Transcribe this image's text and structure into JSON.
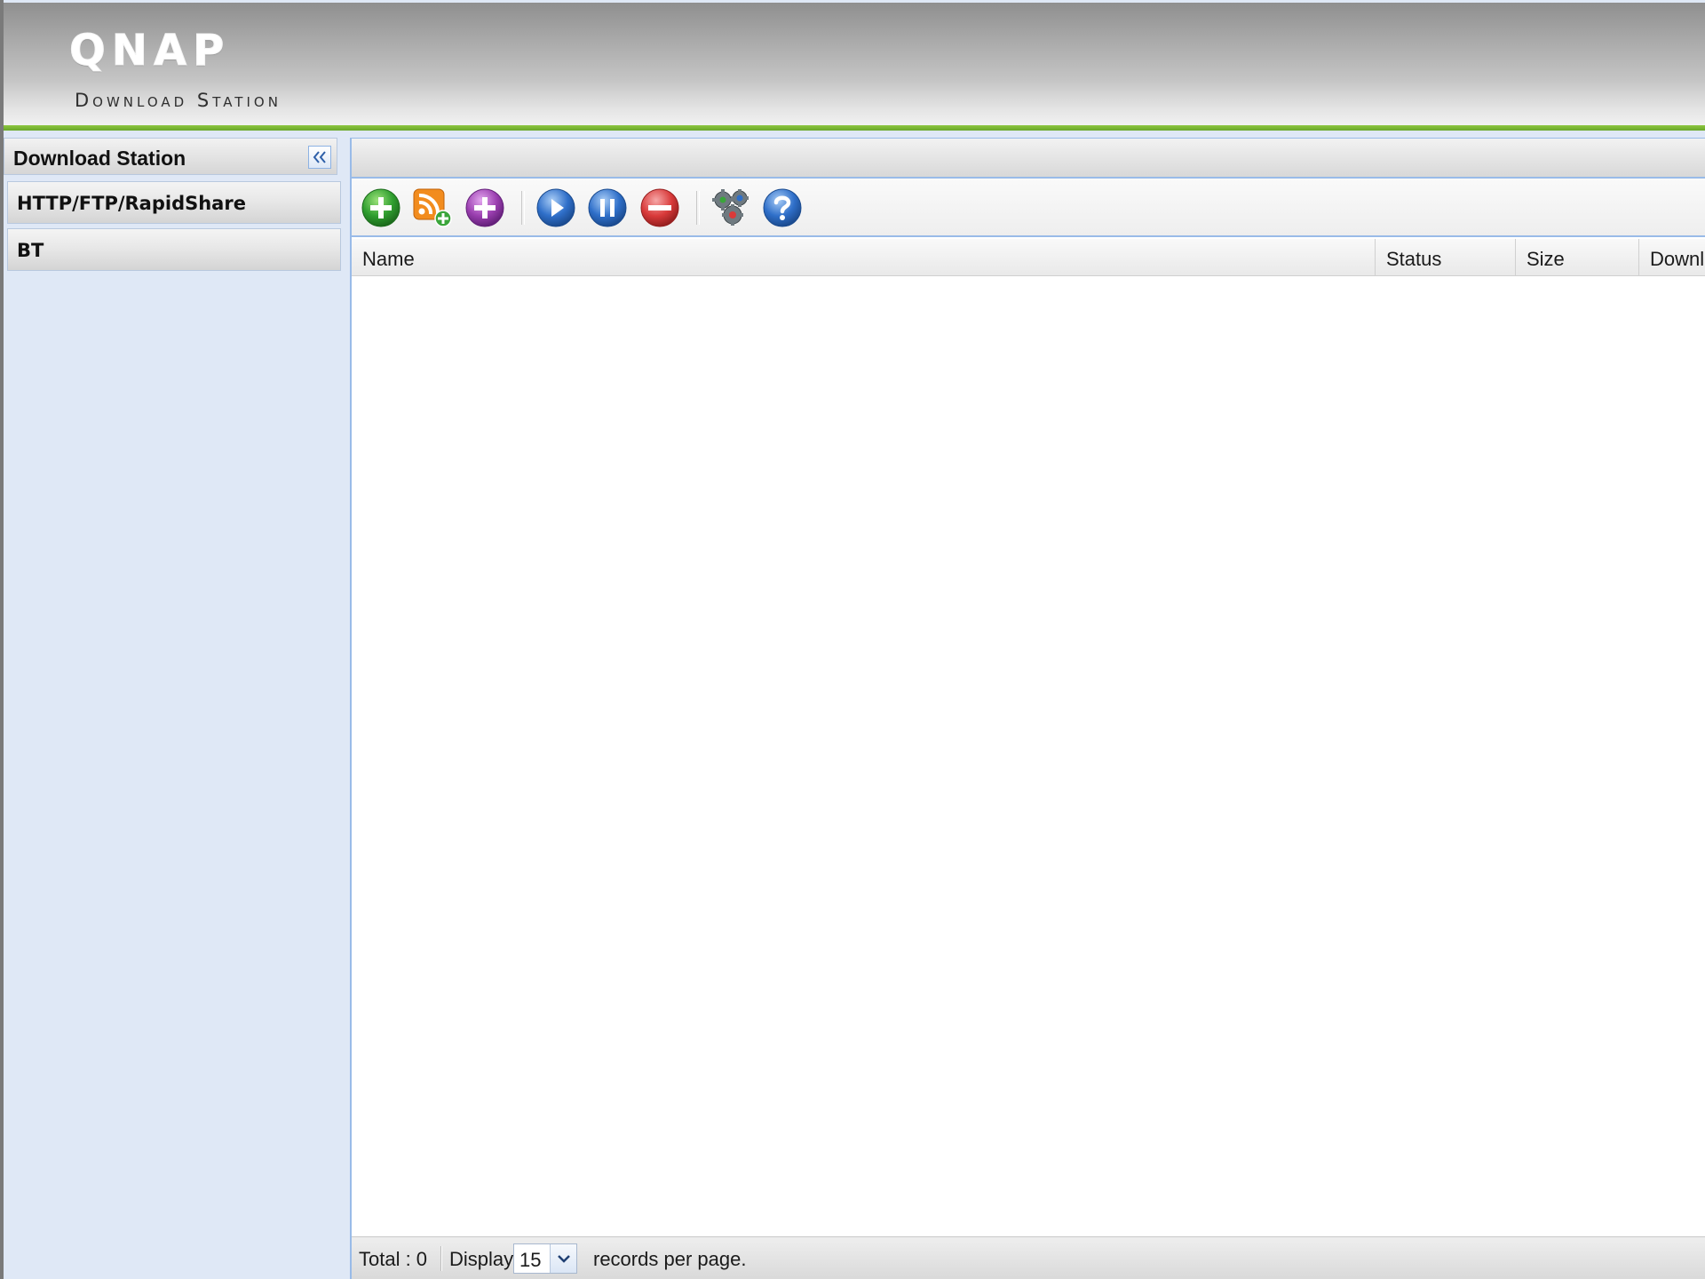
{
  "header": {
    "logo": "QNAP",
    "subtitle": "Download Station"
  },
  "sidebar": {
    "title": "Download Station",
    "collapse_icon": "double-chevron-left-icon",
    "items": [
      {
        "label": "HTTP/FTP/RapidShare"
      },
      {
        "label": "BT"
      }
    ]
  },
  "toolbar": {
    "buttons": [
      {
        "icon": "add-icon",
        "color": "#2f9e2f"
      },
      {
        "icon": "rss-add-icon",
        "color": "#f28c1e"
      },
      {
        "icon": "add-purple-icon",
        "color": "#9b3fb0"
      },
      {
        "icon": "play-icon",
        "color": "#2f6fc9"
      },
      {
        "icon": "pause-icon",
        "color": "#2f6fc9"
      },
      {
        "icon": "remove-icon",
        "color": "#d93a3a"
      },
      {
        "icon": "settings-gears-icon",
        "color": "#6f7a80"
      },
      {
        "icon": "help-icon",
        "color": "#2f6fc9"
      }
    ]
  },
  "grid": {
    "columns": [
      {
        "label": "Name"
      },
      {
        "label": "Status"
      },
      {
        "label": "Size"
      },
      {
        "label": "Downl"
      }
    ],
    "rows": []
  },
  "paging": {
    "total_label": "Total : 0",
    "display_label": "Display",
    "page_size": "15",
    "suffix": "records per page."
  },
  "colors": {
    "accent_green": "#7ab83a",
    "panel_border": "#99bbe8",
    "sidebar_bg": "#dfe8f6"
  }
}
